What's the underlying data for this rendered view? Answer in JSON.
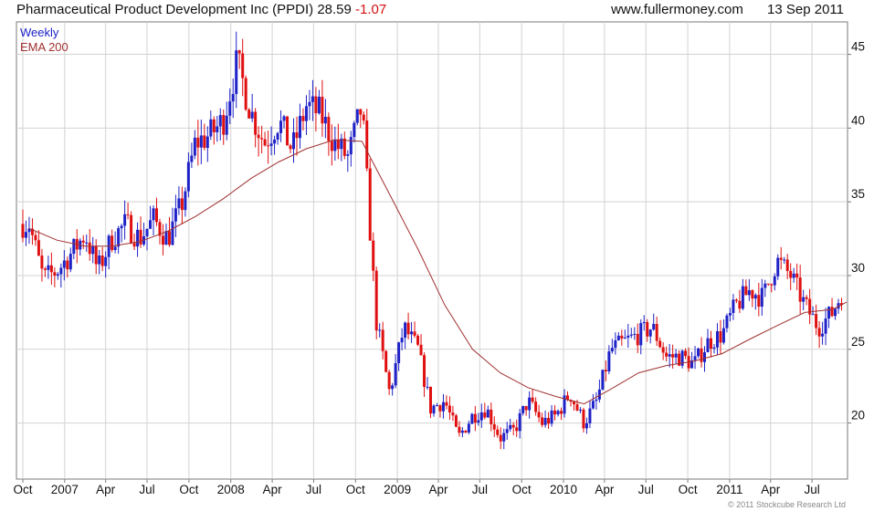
{
  "header": {
    "company": "Pharmaceutical Product Development Inc (PPDI)",
    "price": "28.59",
    "change": "-1.07",
    "site": "www.fullermoney.com",
    "date": "13 Sep 2011"
  },
  "legend": {
    "weekly": "Weekly",
    "ema": "EMA 200"
  },
  "copyright": "© 2011 Stockcube Research Ltd",
  "colors": {
    "up": "#1e22c8",
    "down": "#e01010",
    "ema": "#a03030",
    "grid": "#d2d2d2",
    "frame": "#7a7a7a"
  },
  "chart_data": {
    "type": "candlestick",
    "interval": "weekly",
    "ylim": [
      16.2,
      47.2
    ],
    "yticks": [
      20,
      25,
      30,
      35,
      40,
      45
    ],
    "x_tick_labels": [
      "Oct",
      "2007",
      "Apr",
      "Jul",
      "Oct",
      "2008",
      "Apr",
      "Jul",
      "Oct",
      "2009",
      "Apr",
      "Jul",
      "Oct",
      "2010",
      "Apr",
      "Jul",
      "Oct",
      "2011",
      "Apr",
      "Jul"
    ],
    "price_path": [
      [
        "2006-10",
        33.5
      ],
      [
        "2006-11",
        29.8
      ],
      [
        "2006-12",
        30.3
      ],
      [
        "2007-01",
        31.5
      ],
      [
        "2007-02",
        32.8
      ],
      [
        "2007-03",
        30.4
      ],
      [
        "2007-04",
        32.5
      ],
      [
        "2007-05",
        33.5
      ],
      [
        "2007-06",
        32.5
      ],
      [
        "2007-07",
        33.8
      ],
      [
        "2007-08",
        32.5
      ],
      [
        "2007-09",
        34.8
      ],
      [
        "2007-10",
        39.0
      ],
      [
        "2007-11",
        39.5
      ],
      [
        "2007-12",
        40.5
      ],
      [
        "2008-01",
        44.5
      ],
      [
        "2008-02",
        41.0
      ],
      [
        "2008-03",
        39.0
      ],
      [
        "2008-04",
        40.5
      ],
      [
        "2008-05",
        38.5
      ],
      [
        "2008-06",
        41.5
      ],
      [
        "2008-07",
        41.0
      ],
      [
        "2008-08",
        39.0
      ],
      [
        "2008-09",
        38.0
      ],
      [
        "2008-10",
        41.5
      ],
      [
        "2008-11",
        27.0
      ],
      [
        "2008-12",
        22.0
      ],
      [
        "2009-01",
        26.5
      ],
      [
        "2009-02",
        25.0
      ],
      [
        "2009-03",
        21.0
      ],
      [
        "2009-04",
        21.5
      ],
      [
        "2009-05",
        19.0
      ],
      [
        "2009-06",
        20.5
      ],
      [
        "2009-07",
        21.0
      ],
      [
        "2009-08",
        19.0
      ],
      [
        "2009-09",
        19.5
      ],
      [
        "2009-10",
        21.5
      ],
      [
        "2009-11",
        20.0
      ],
      [
        "2009-12",
        20.5
      ],
      [
        "2010-01",
        22.0
      ],
      [
        "2010-02",
        20.0
      ],
      [
        "2010-03",
        21.5
      ],
      [
        "2010-04",
        25.0
      ],
      [
        "2010-05",
        25.5
      ],
      [
        "2010-06",
        26.0
      ],
      [
        "2010-07",
        26.5
      ],
      [
        "2010-08",
        24.5
      ],
      [
        "2010-09",
        24.5
      ],
      [
        "2010-10",
        24.0
      ],
      [
        "2010-11",
        25.5
      ],
      [
        "2010-12",
        26.0
      ],
      [
        "2011-01",
        28.0
      ],
      [
        "2011-02",
        29.0
      ],
      [
        "2011-03",
        28.5
      ],
      [
        "2011-04",
        31.0
      ],
      [
        "2011-05",
        30.0
      ],
      [
        "2011-06",
        28.0
      ],
      [
        "2011-07",
        26.5
      ],
      [
        "2011-08",
        27.5
      ],
      [
        "2011-09",
        29.5
      ]
    ],
    "ema_200": [
      [
        "2006-10",
        33.2
      ],
      [
        "2006-12",
        32.4
      ],
      [
        "2007-02",
        32.0
      ],
      [
        "2007-04",
        32.0
      ],
      [
        "2007-06",
        32.3
      ],
      [
        "2007-08",
        33.0
      ],
      [
        "2007-10",
        34.0
      ],
      [
        "2007-12",
        35.2
      ],
      [
        "2008-02",
        36.6
      ],
      [
        "2008-04",
        37.7
      ],
      [
        "2008-06",
        38.6
      ],
      [
        "2008-08",
        39.2
      ],
      [
        "2008-10",
        39.1
      ],
      [
        "2008-12",
        35.5
      ],
      [
        "2009-02",
        31.8
      ],
      [
        "2009-04",
        28.0
      ],
      [
        "2009-06",
        25.0
      ],
      [
        "2009-08",
        23.4
      ],
      [
        "2009-10",
        22.4
      ],
      [
        "2009-12",
        21.8
      ],
      [
        "2010-02",
        21.3
      ],
      [
        "2010-04",
        22.3
      ],
      [
        "2010-06",
        23.4
      ],
      [
        "2010-08",
        23.9
      ],
      [
        "2010-10",
        24.2
      ],
      [
        "2010-12",
        24.7
      ],
      [
        "2011-02",
        25.7
      ],
      [
        "2011-04",
        26.6
      ],
      [
        "2011-06",
        27.5
      ],
      [
        "2011-08",
        27.7
      ],
      [
        "2011-09",
        28.2
      ]
    ]
  }
}
